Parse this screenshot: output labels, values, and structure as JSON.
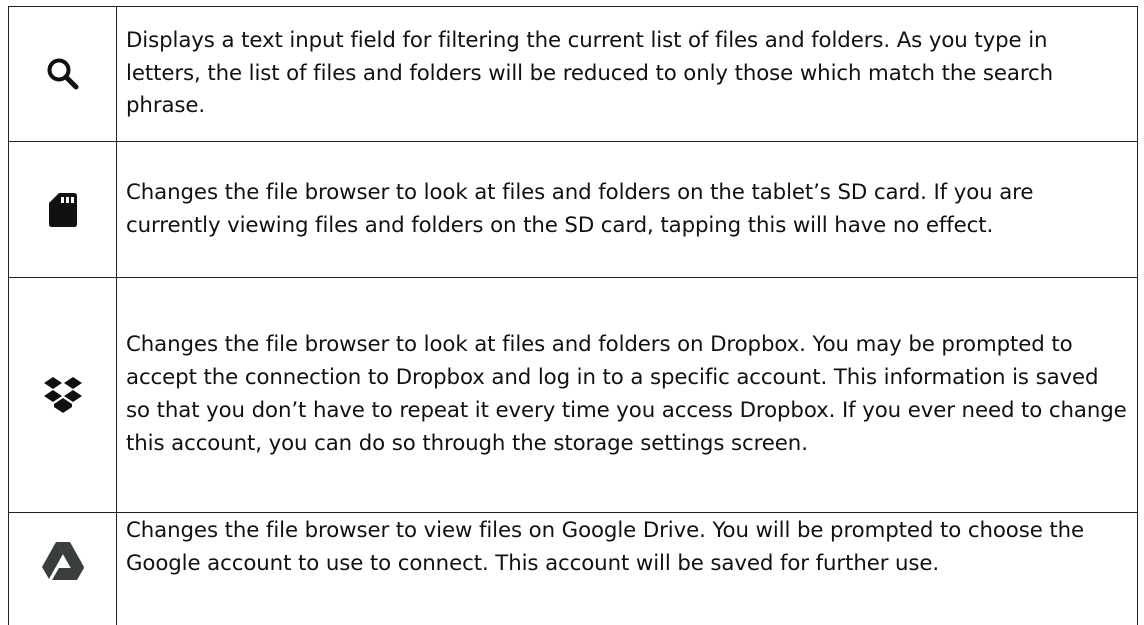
{
  "rows": [
    {
      "icon": "search-icon",
      "description": "Displays a text input field for filtering the current list of files and folders. As you type in letters, the list of files and folders will be reduced to only those which match the search phrase."
    },
    {
      "icon": "sd-card-icon",
      "description": "Changes the file browser to look at files and folders on the tablet’s SD card. If you are currently viewing files and folders on the SD card, tapping this will have no effect."
    },
    {
      "icon": "dropbox-icon",
      "description": "Changes the file browser to look at files and folders on Dropbox. You may be prompted to accept the connection to Dropbox and log in to a specific account. This information is saved so that you don’t have to repeat it every time you access Dropbox. If you ever need to change this account, you can do so through the storage settings screen."
    },
    {
      "icon": "google-drive-icon",
      "description": "Changes the file browser to view files on Google Drive. You will be prompted to choose the Google account to use to connect. This account will be saved for further use."
    }
  ],
  "colors": {
    "text": "#111111",
    "border": "#222222",
    "icon_dark": "#111111",
    "drive_icon": "#3a3f3d"
  }
}
